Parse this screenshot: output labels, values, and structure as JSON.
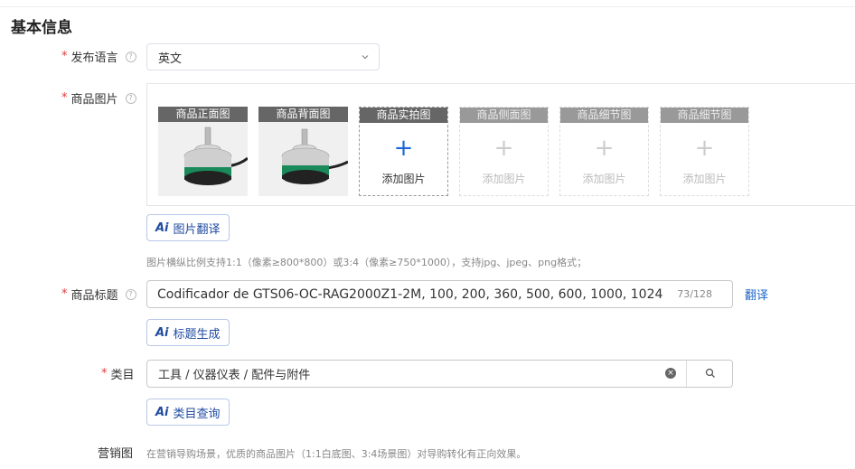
{
  "section": {
    "title": "基本信息"
  },
  "language": {
    "label": "发布语言",
    "value": "英文"
  },
  "images": {
    "label": "商品图片",
    "slots": [
      {
        "caption": "商品正面图"
      },
      {
        "caption": "商品背面图"
      },
      {
        "caption": "商品实拍图",
        "add_label": "添加图片"
      },
      {
        "caption": "商品侧面图",
        "add_label": "添加图片"
      },
      {
        "caption": "商品细节图",
        "add_label": "添加图片"
      },
      {
        "caption": "商品细节图",
        "add_label": "添加图片"
      }
    ],
    "translate_button": "图片翻译",
    "hint": "图片横纵比例支持1:1（像素≥800*800）或3:4（像素≥750*1000），支持jpg、jpeg、png格式；"
  },
  "product_title": {
    "label": "商品标题",
    "value": "Codificador de GTS06-OC-RAG2000Z1-2M, 100, 200, 360, 500, 600, 1000, 1024",
    "count": "73/128",
    "translate_link": "翻译",
    "generate_button": "标题生成"
  },
  "category": {
    "label": "类目",
    "value": "工具 / 仪器仪表 / 配件与附件",
    "query_button": "类目查询"
  },
  "marketing": {
    "label": "营销图",
    "hint": "在营销导购场景，优质的商品图片（1:1白底图、3:4场景图）对导购转化有正向效果。"
  },
  "ai_badge": "Ai",
  "help_glyph": "?",
  "required_mark": "*",
  "colors": {
    "accent": "#1f66c8",
    "required": "#e4393c",
    "caption_bg": "#666666"
  }
}
